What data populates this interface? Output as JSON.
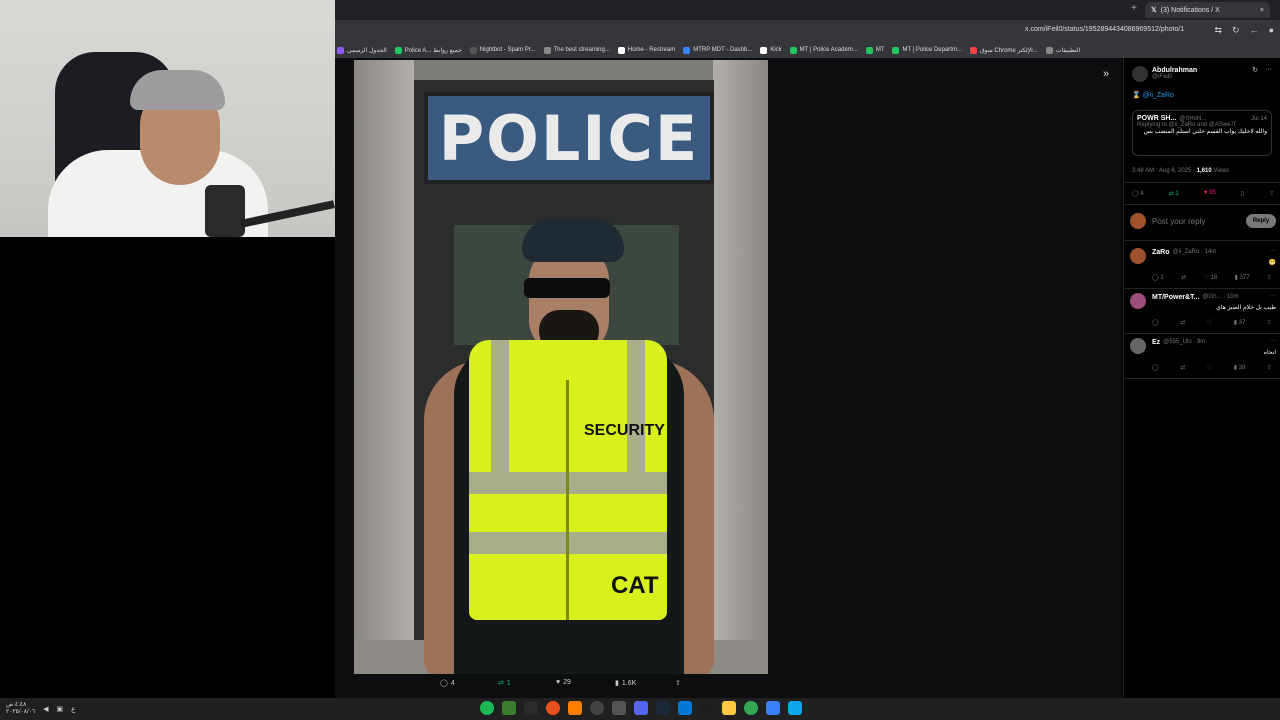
{
  "browser": {
    "tab_title": "(3) Notifications / X",
    "url": "x.com/iFeil0/status/1952894434086969512/photo/1",
    "bookmarks": [
      {
        "label": "الجدول الرسمي",
        "color": "#8b5cf6"
      },
      {
        "label": "Police A... جميع روابط",
        "color": "#22c55e"
      },
      {
        "label": "Nightbot - Spam Pr...",
        "color": "#555"
      },
      {
        "label": "The best streaming...",
        "color": "#888"
      },
      {
        "label": "Home - Restream",
        "color": "#fff"
      },
      {
        "label": "MTRP MDT - Dashb...",
        "color": "#3b82f6"
      },
      {
        "label": "Kick",
        "color": "#fff"
      },
      {
        "label": "MT | Police Academ...",
        "color": "#22c55e"
      },
      {
        "label": "MT",
        "color": "#22c55e"
      },
      {
        "label": "MT | Police Departm...",
        "color": "#22c55e"
      },
      {
        "label": "سوق Chrome الإلكتر...",
        "color": "#ef4444"
      },
      {
        "label": "التطبيقات",
        "color": "#888"
      }
    ]
  },
  "photo": {
    "sign_text": "POLICE",
    "vest_text": "SECURITY",
    "vest_name": "CAT"
  },
  "photo_actions": {
    "replies": "4",
    "reposts": "1",
    "likes": "29",
    "views": "1.6K"
  },
  "sidebar": {
    "author_name": "Abdulrahman",
    "author_handle": "@iFeil0",
    "mention": "@ii_ZaRo",
    "quote": {
      "name": "POWR SH...",
      "handle": "@SHoN...",
      "date": "Jul 14",
      "replying": "Replying to @ii_ZaRo and @ASwe7f",
      "text": "والله لاخليك بواب القسم خلني استلم المنصب بس"
    },
    "timestamp": "3:48 AM · Aug 6, 2025 · ",
    "views_count": "1,610",
    "views_label": "Views",
    "stats": {
      "replies": "4",
      "reposts": "1",
      "likes": "35"
    },
    "reply_placeholder": "Post your reply",
    "reply_button": "Reply",
    "comments": [
      {
        "name": "ZaRo",
        "handle": "@ii_ZaRo · 14m",
        "text": "😬",
        "replies": "1",
        "likes": "18",
        "views": "377",
        "avatar": "#a0522d"
      },
      {
        "name": "MT/Power&T...",
        "handle": "@Gh... · 10m",
        "text": "طيب بل خلام الصبر هاي",
        "replies": "",
        "likes": "",
        "views": "37",
        "avatar": "#9b4d7c"
      },
      {
        "name": "Ez",
        "handle": "@555_Ulo · 9m",
        "text": "انحاه",
        "replies": "",
        "likes": "",
        "views": "38",
        "avatar": "#666"
      }
    ]
  },
  "taskbar": {
    "time": "٤:٤٨ ص",
    "date": "٢٠٢٥/٠٨/٠٦",
    "lang": "ع"
  }
}
